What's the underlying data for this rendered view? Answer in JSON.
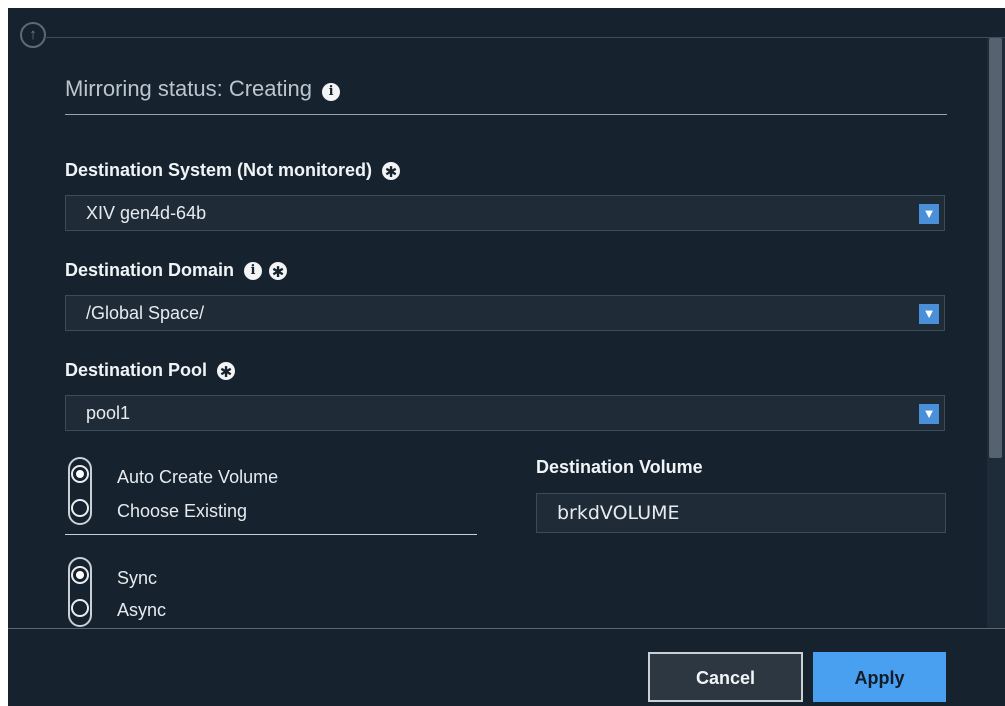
{
  "mirroring_status": {
    "label": "Mirroring status: Creating"
  },
  "destination_system": {
    "label": "Destination System (Not monitored)",
    "value": "XIV gen4d-64b"
  },
  "destination_domain": {
    "label": "Destination Domain",
    "value": "/Global Space/"
  },
  "destination_pool": {
    "label": "Destination Pool",
    "value": "pool1"
  },
  "volume_mode": {
    "options": [
      "Auto Create Volume",
      "Choose Existing"
    ],
    "selected": "Auto Create Volume"
  },
  "destination_volume": {
    "label": "Destination Volume",
    "value": "brkdVOLUME"
  },
  "sync_mode": {
    "options": [
      "Sync",
      "Async"
    ],
    "selected": "Sync"
  },
  "footer": {
    "cancel_label": "Cancel",
    "apply_label": "Apply"
  },
  "icons": {
    "up": "arrow-up-circle-icon",
    "info": "info-icon",
    "required": "asterisk-required-icon",
    "dropdown": "chevron-down-icon"
  },
  "colors": {
    "background": "#16222e",
    "accent": "#4aa0f0"
  }
}
